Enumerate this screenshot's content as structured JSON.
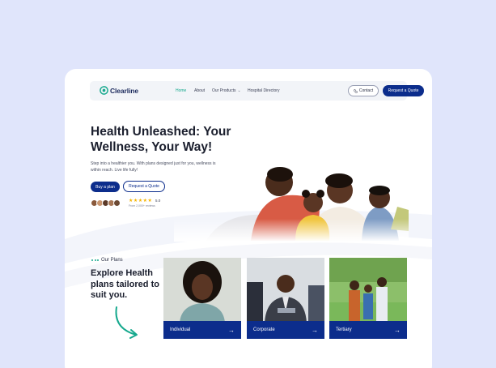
{
  "brand": {
    "name": "Clearline",
    "accent": "#17a98e",
    "primary": "#0c2d8c"
  },
  "nav": {
    "links": [
      "Home",
      "About",
      "Our Products",
      "Hospital Directory"
    ],
    "contact_label": "Contact",
    "quote_label": "Request a Quote"
  },
  "hero": {
    "title": "Health Unleashed: Your Wellness, Your Way!",
    "description": "Step into a healthier you. With plans designed just for you, wellness is within reach. Live life fully!",
    "buy_label": "Buy a plan",
    "request_label": "Request a Quote",
    "stars": "★★★★★",
    "rating": "5.0",
    "rating_note": "From 2,000+ reviews"
  },
  "plans": {
    "tag": "Our Plans",
    "title": "Explore Health plans tailored to suit you.",
    "items": [
      {
        "label": "Individual"
      },
      {
        "label": "Corporate"
      },
      {
        "label": "Tertiary"
      }
    ]
  }
}
